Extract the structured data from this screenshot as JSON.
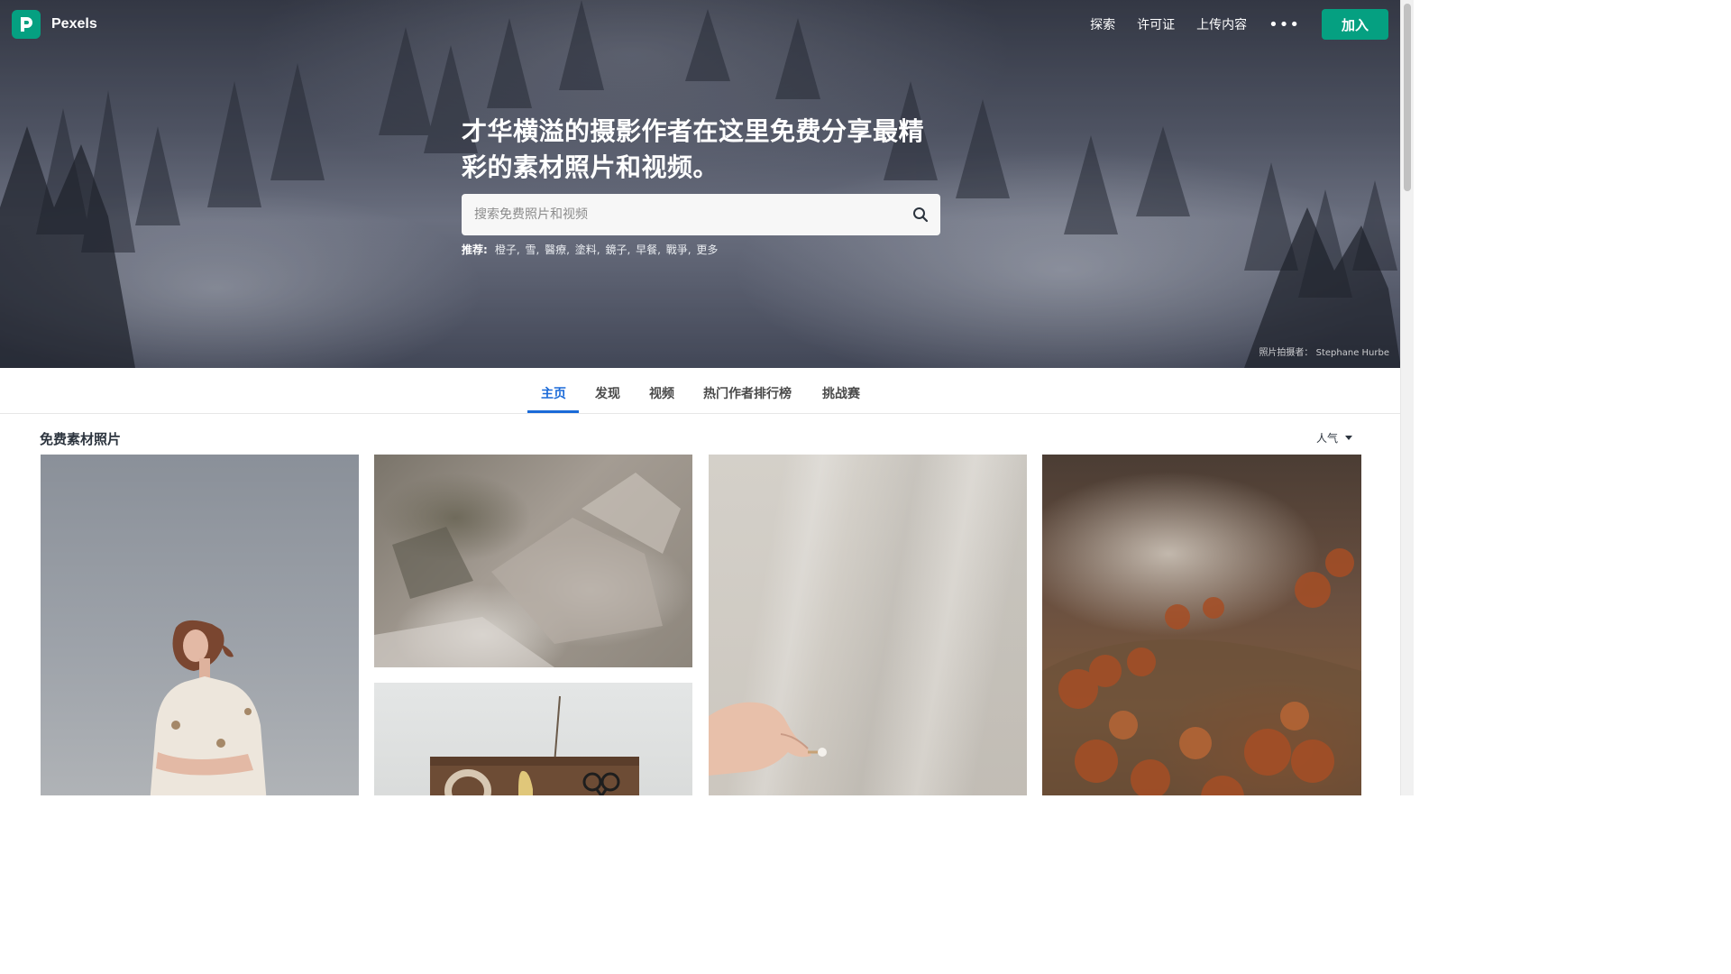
{
  "brand": {
    "name": "Pexels",
    "accent": "#05a081"
  },
  "nav": {
    "items": [
      "探索",
      "许可证",
      "上传内容"
    ],
    "more_label": "•••",
    "join_label": "加入"
  },
  "hero": {
    "title": "才华横溢的摄影作者在这里免费分享最精彩的素材照片和视频。",
    "search": {
      "placeholder": "搜索免费照片和视频",
      "icon": "search-icon"
    },
    "suggestions": {
      "label": "推荐:",
      "tags": [
        "橙子",
        "雪",
        "醫療",
        "塗料",
        "鏡子",
        "早餐",
        "戰爭",
        "更多"
      ]
    },
    "credit": "照片拍摄者： Stephane Hurbe"
  },
  "tabs": {
    "items": [
      "主页",
      "发现",
      "视频",
      "热门作者排行榜",
      "挑战赛"
    ],
    "active": "主页",
    "active_color": "#1a6ad8"
  },
  "section": {
    "title": "免费素材照片",
    "sort_label": "人气"
  }
}
